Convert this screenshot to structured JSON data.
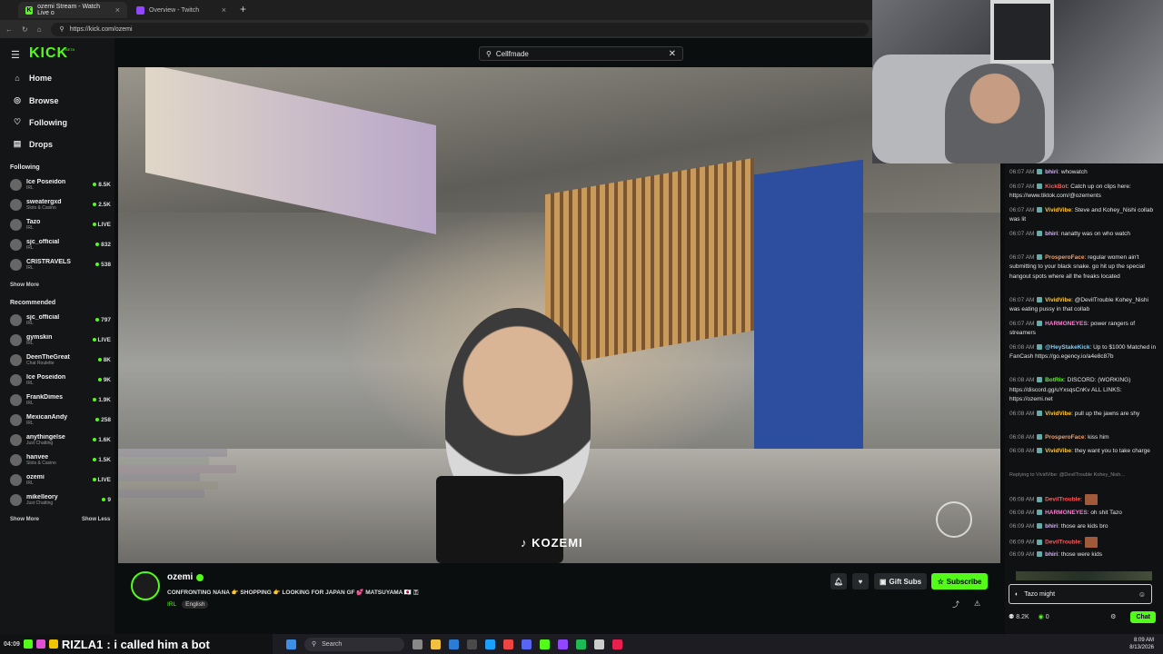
{
  "browser": {
    "tabs": [
      {
        "label": "ozemi Stream - Watch Live o",
        "active": true
      },
      {
        "label": "Overview - Twitch",
        "active": false
      }
    ],
    "new_tab": "+",
    "url": "https://kick.com/ozemi"
  },
  "kick": {
    "logo": "KICK",
    "beta": "BETA",
    "search": {
      "value": "Cellfmade"
    },
    "nav": [
      {
        "label": "Home",
        "icon": "home-icon"
      },
      {
        "label": "Browse",
        "icon": "compass-icon"
      },
      {
        "label": "Following",
        "icon": "heart-icon"
      },
      {
        "label": "Drops",
        "icon": "drops-icon"
      }
    ],
    "following_header": "Following",
    "following": [
      {
        "name": "Ice Poseidon",
        "category": "IRL",
        "viewers": "8.5K"
      },
      {
        "name": "sweatergxd",
        "category": "Slots & Casino",
        "viewers": "2.5K"
      },
      {
        "name": "Tazo",
        "category": "IRL",
        "viewers": "LIVE"
      },
      {
        "name": "sjc_official",
        "category": "IRL",
        "viewers": "832"
      },
      {
        "name": "CRISTRAVELS",
        "category": "IRL",
        "viewers": "538"
      }
    ],
    "following_show_more": "Show More",
    "recommended_header": "Recommended",
    "recommended": [
      {
        "name": "sjc_official",
        "category": "IRL",
        "viewers": "797"
      },
      {
        "name": "gymskin",
        "category": "IRL",
        "viewers": "LIVE"
      },
      {
        "name": "DeenTheGreat",
        "category": "Chat Roulette",
        "viewers": "8K"
      },
      {
        "name": "Ice Poseidon",
        "category": "IRL",
        "viewers": "9K"
      },
      {
        "name": "FrankDimes",
        "category": "IRL",
        "viewers": "1.9K"
      },
      {
        "name": "MexicanAndy",
        "category": "IRL",
        "viewers": "258"
      },
      {
        "name": "anythingelse",
        "category": "Just Chatting",
        "viewers": "1.6K"
      },
      {
        "name": "hanvee",
        "category": "Slots & Casino",
        "viewers": "1.5K"
      },
      {
        "name": "ozemi",
        "category": "IRL",
        "viewers": "LIVE"
      },
      {
        "name": "mikelleory",
        "category": "Just Chatting",
        "viewers": "9"
      }
    ],
    "show_more": "Show More",
    "show_less": "Show Less",
    "video_watermark": "♪ KOZEMI",
    "channel": {
      "name": "ozemi",
      "title": "CONFRONTING NANA 👉 SHOPPING 👉 LOOKING FOR JAPAN GF 💕 MATSUYAMA 🇯🇵 🇹",
      "category": "IRL",
      "language": "English",
      "gift_subs": "Gift Subs",
      "subscribe": "Subscribe"
    },
    "chat": {
      "messages": [
        {
          "time": "06:07 AM",
          "user": "bhiri",
          "color": "#d9b6ff",
          "text": "whowatch"
        },
        {
          "time": "06:07 AM",
          "user": "KickBot",
          "color": "#ff5a5a",
          "text": "Catch up on clips here: https://www.tiktok.com/@ozements"
        },
        {
          "time": "06:07 AM",
          "user": "VividVibe",
          "color": "#ffc93c",
          "text": "Steve and Kohey_Nishi collab was lit"
        },
        {
          "time": "06:07 AM",
          "user": "bhiri",
          "color": "#d9b6ff",
          "text": "nanatty was on who watch"
        },
        {
          "time": "06:07 AM",
          "user": "ProsperoFace",
          "color": "#ff9d5c",
          "text": "regular women ain't submitting to your black snake. go hit up the special hangout spots where all the freaks located"
        },
        {
          "time": "06:07 AM",
          "user": "VividVibe",
          "color": "#ffc93c",
          "text": "@DevilTrouble Kohey_Nishi was eating pussy in that collab"
        },
        {
          "time": "06:07 AM",
          "user": "HARMONEYES",
          "color": "#ff7bd5",
          "text": "power rangers of streamers"
        },
        {
          "time": "06:08 AM",
          "user": "@HeyStakeKick",
          "color": "#7fd0ff",
          "text": "Up to $1000 Matched in FanCash https://go.egency.io/a4e8c87b"
        },
        {
          "time": "06:08 AM",
          "user": "BotRix",
          "color": "#53fc18",
          "text": "DISCORD: (WORKING) https://discord.gg/uYxsqsCnKv ALL LINKS: https://ozemi.net"
        },
        {
          "time": "06:08 AM",
          "user": "VividVibe",
          "color": "#ffc93c",
          "text": "pull up the jawns are shy"
        },
        {
          "time": "06:08 AM",
          "user": "ProsperoFace",
          "color": "#ff9d5c",
          "text": "kiss him"
        },
        {
          "time": "06:08 AM",
          "user": "VividVibe",
          "color": "#ffc93c",
          "text": "they want you to take charge"
        },
        {
          "time": "",
          "user": "",
          "color": "#888888",
          "text": "Replying to VividVibe: @DevilTrouble Kohey_Nish..."
        },
        {
          "time": "06:08 AM",
          "user": "DevilTrouble",
          "color": "#ff5a5a",
          "text": ""
        },
        {
          "time": "06:08 AM",
          "user": "HARMONEYES",
          "color": "#ff7bd5",
          "text": "oh shit Tazo"
        },
        {
          "time": "06:09 AM",
          "user": "bhiri",
          "color": "#d9b6ff",
          "text": "those are kids bro"
        },
        {
          "time": "06:09 AM",
          "user": "DevilTrouble",
          "color": "#ff5a5a",
          "text": ""
        },
        {
          "time": "06:09 AM",
          "user": "bhiri",
          "color": "#d9b6ff",
          "text": "those were kids"
        }
      ],
      "input_value": "Tazo might",
      "viewers": "8.2K",
      "points": "0",
      "send": "Chat"
    }
  },
  "overlay_alert": {
    "timecode": "04:09",
    "user": "RIZLA1",
    "text": ": i called him a bot"
  },
  "taskbar": {
    "search": "Search",
    "time": "8:09 AM",
    "date": "8/13/2026"
  }
}
